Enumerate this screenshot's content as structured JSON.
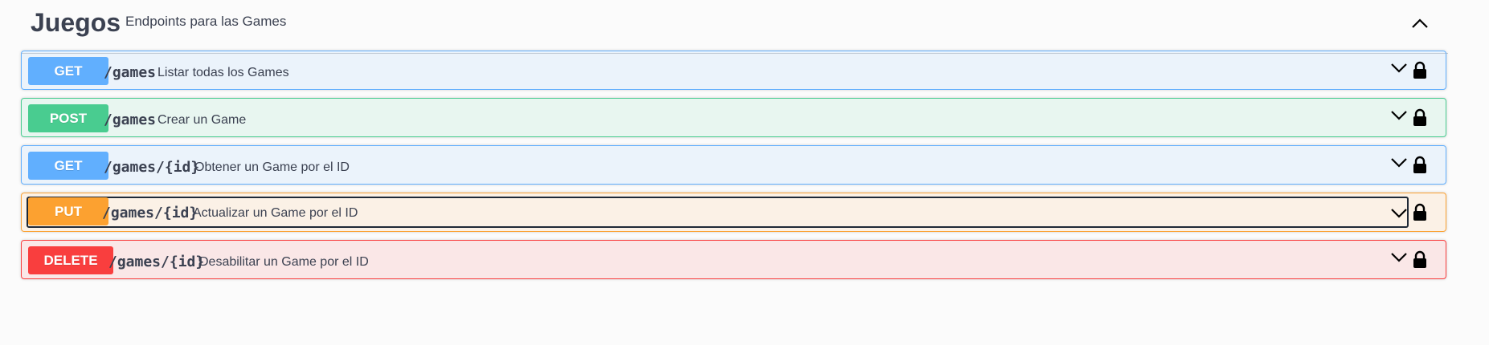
{
  "tag": {
    "name": "Juegos",
    "description": "Endpoints para las Games",
    "toggle_icon": "chevron-up-icon"
  },
  "operations": [
    {
      "method": "GET",
      "path": "/games",
      "summary": "Listar todas los Games",
      "color": "#61affe",
      "focused": false
    },
    {
      "method": "POST",
      "path": "/games",
      "summary": "Crear un Game",
      "color": "#49cc90",
      "focused": false
    },
    {
      "method": "GET",
      "path": "/games/{id}",
      "summary": "Obtener un Game por el ID",
      "color": "#61affe",
      "focused": false
    },
    {
      "method": "PUT",
      "path": "/games/{id}",
      "summary": "Actualizar un Game por el ID",
      "color": "#fca130",
      "focused": true
    },
    {
      "method": "DELETE",
      "path": "/games/{id}",
      "summary": "Desabilitar un Game por el ID",
      "color": "#f93e3e",
      "focused": false
    }
  ],
  "icons": {
    "expand": "chevron-down-icon",
    "auth": "lock-icon"
  }
}
